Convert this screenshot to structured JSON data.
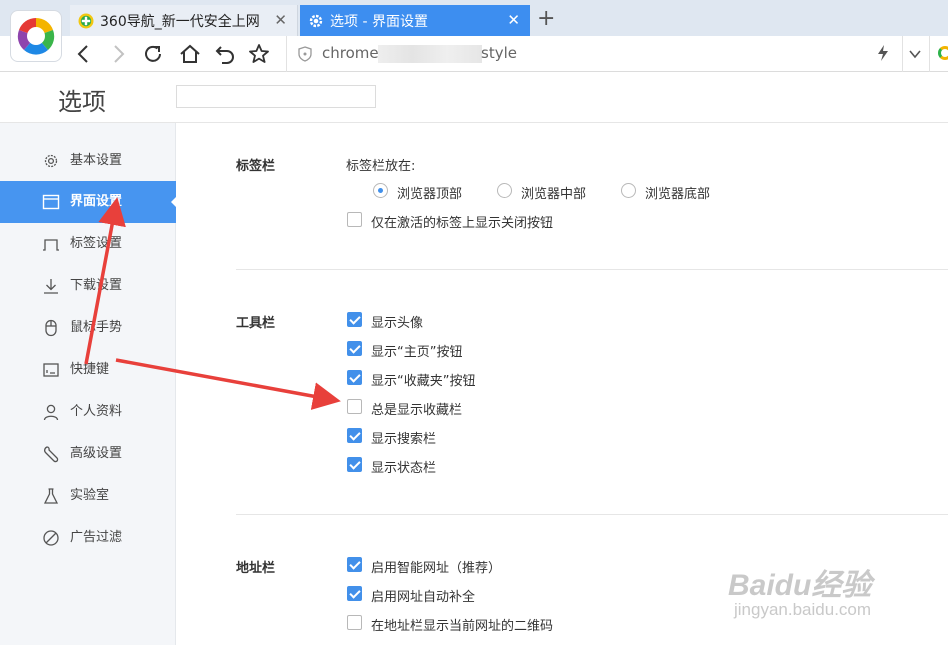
{
  "browser": {
    "tabs": [
      {
        "title": "360导航_新一代安全上网",
        "active": false
      },
      {
        "title": "选项 - 界面设置",
        "active": true
      }
    ],
    "address": {
      "prefix": "chrome",
      "suffix": "style"
    }
  },
  "page": {
    "title": "选项"
  },
  "sidebar": {
    "items": [
      {
        "label": "基本设置",
        "icon": "gear-icon"
      },
      {
        "label": "界面设置",
        "icon": "window-icon",
        "active": true
      },
      {
        "label": "标签设置",
        "icon": "tab-icon"
      },
      {
        "label": "下载设置",
        "icon": "download-icon"
      },
      {
        "label": "鼠标手势",
        "icon": "mouse-icon"
      },
      {
        "label": "快捷键",
        "icon": "keyboard-icon"
      },
      {
        "label": "个人资料",
        "icon": "user-icon"
      },
      {
        "label": "高级设置",
        "icon": "wrench-icon"
      },
      {
        "label": "实验室",
        "icon": "flask-icon"
      },
      {
        "label": "广告过滤",
        "icon": "block-icon"
      }
    ]
  },
  "sections": {
    "tabbar": {
      "title": "标签栏",
      "position_label": "标签栏放在:",
      "positions": [
        {
          "label": "浏览器顶部",
          "checked": true
        },
        {
          "label": "浏览器中部",
          "checked": false
        },
        {
          "label": "浏览器底部",
          "checked": false
        }
      ],
      "close_btn_option": {
        "label": "仅在激活的标签上显示关闭按钮",
        "checked": false
      }
    },
    "toolbar": {
      "title": "工具栏",
      "options": [
        {
          "label": "显示头像",
          "checked": true
        },
        {
          "label": "显示“主页”按钮",
          "checked": true
        },
        {
          "label": "显示“收藏夹”按钮",
          "checked": true
        },
        {
          "label": "总是显示收藏栏",
          "checked": false
        },
        {
          "label": "显示搜索栏",
          "checked": true
        },
        {
          "label": "显示状态栏",
          "checked": true
        }
      ]
    },
    "addressbar": {
      "title": "地址栏",
      "options": [
        {
          "label": "启用智能网址（推荐）",
          "checked": true
        },
        {
          "label": "启用网址自动补全",
          "checked": true
        },
        {
          "label": "在地址栏显示当前网址的二维码",
          "checked": false
        }
      ]
    }
  },
  "watermark": {
    "brand": "Baidu经验",
    "url": "jingyan.baidu.com"
  },
  "colors": {
    "accent": "#4795f0",
    "tab_active": "#3d8ef0",
    "annotation_arrow": "#e8403b"
  }
}
